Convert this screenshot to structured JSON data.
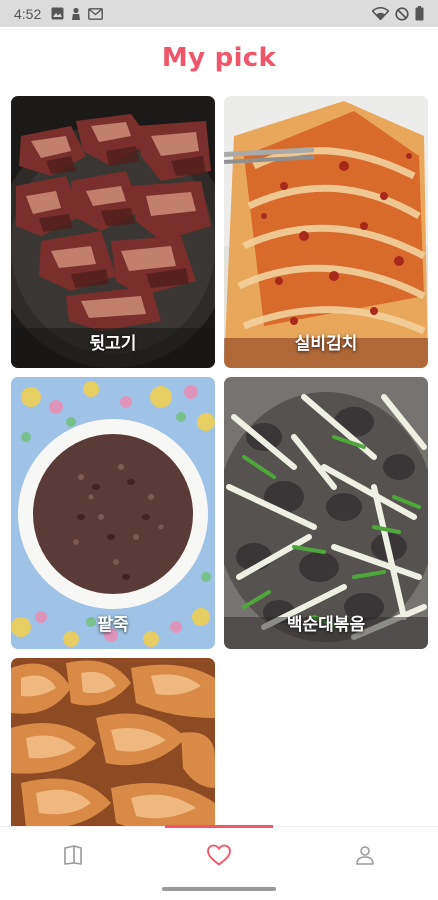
{
  "status_bar": {
    "time": "4:52",
    "left_icons": [
      "image-icon",
      "person-pin-icon",
      "gmail-icon"
    ],
    "right_icons": [
      "wifi-icon",
      "do-not-disturb-icon",
      "battery-icon"
    ]
  },
  "header": {
    "title": "My pick"
  },
  "picks": [
    {
      "label": "뒷고기"
    },
    {
      "label": "실비김치"
    },
    {
      "label": "팥죽"
    },
    {
      "label": "백순대볶음"
    },
    {
      "label": ""
    }
  ],
  "bottom_nav": {
    "items": [
      {
        "icon": "book-icon",
        "active": false
      },
      {
        "icon": "heart-icon",
        "active": true
      },
      {
        "icon": "person-icon",
        "active": false
      }
    ],
    "accent": "#f0566a"
  }
}
